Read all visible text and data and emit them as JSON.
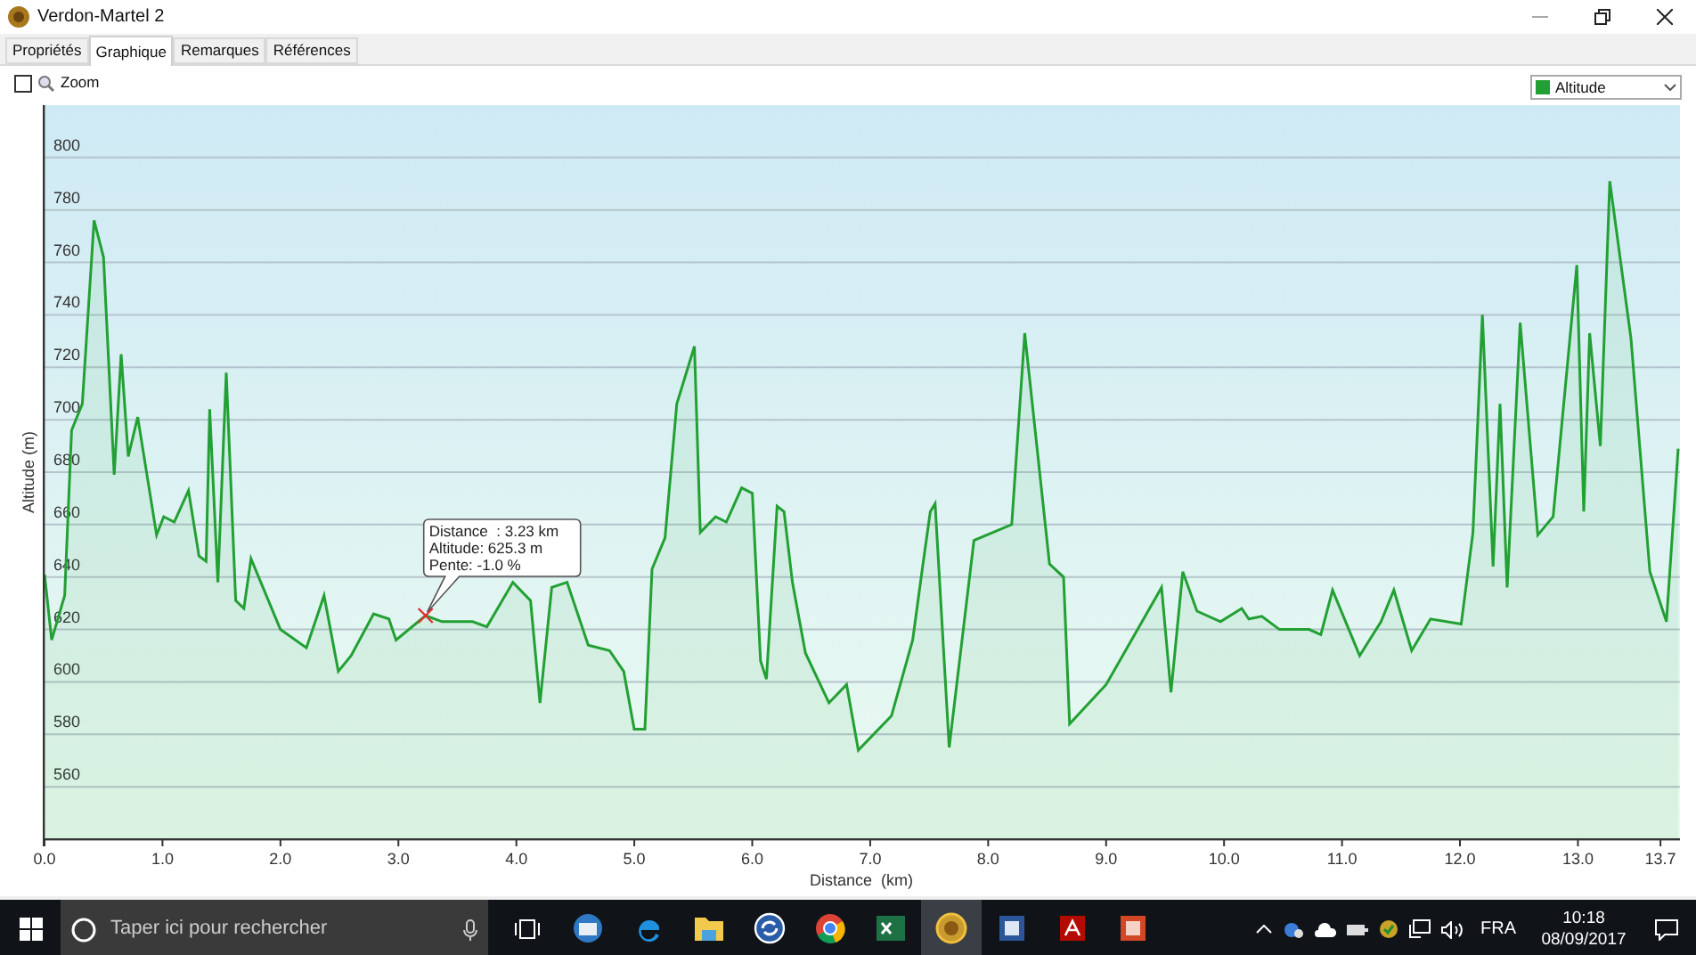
{
  "window": {
    "title": "Verdon-Martel 2"
  },
  "tabs": [
    {
      "label": "Propriétés",
      "selected": false
    },
    {
      "label": "Graphique",
      "selected": true
    },
    {
      "label": "Remarques",
      "selected": false
    },
    {
      "label": "Références",
      "selected": false
    }
  ],
  "toolbar": {
    "zoom": {
      "label": "Zoom",
      "checked": false
    }
  },
  "chart": {
    "chart_data": {
      "type": "area",
      "grid": true,
      "xlabel": "Distance  (km)",
      "ylabel": "Altitude (m)",
      "xlim": [
        0,
        13.85
      ],
      "ylim": [
        540,
        820
      ],
      "xticks": [
        {
          "value": 0,
          "label": "0.0"
        },
        {
          "value": 1,
          "label": "1.0"
        },
        {
          "value": 2,
          "label": "2.0"
        },
        {
          "value": 3,
          "label": "3.0"
        },
        {
          "value": 4,
          "label": "4.0"
        },
        {
          "value": 5,
          "label": "5.0"
        },
        {
          "value": 6,
          "label": "6.0"
        },
        {
          "value": 7,
          "label": "7.0"
        },
        {
          "value": 8,
          "label": "8.0"
        },
        {
          "value": 9,
          "label": "9.0"
        },
        {
          "value": 10,
          "label": "10.0"
        },
        {
          "value": 11,
          "label": "11.0"
        },
        {
          "value": 12,
          "label": "12.0"
        },
        {
          "value": 13,
          "label": "13.0"
        },
        {
          "value": 13.7,
          "label": "13.7"
        }
      ],
      "yticks": [
        560,
        580,
        600,
        620,
        640,
        660,
        680,
        700,
        720,
        740,
        760,
        780,
        800
      ],
      "x": [
        0,
        0.06,
        0.17,
        0.23,
        0.32,
        0.42,
        0.5,
        0.59,
        0.65,
        0.71,
        0.79,
        0.95,
        1.01,
        1.1,
        1.22,
        1.31,
        1.37,
        1.4,
        1.47,
        1.54,
        1.62,
        1.69,
        1.75,
        2.0,
        2.22,
        2.37,
        2.49,
        2.6,
        2.79,
        2.92,
        2.98,
        3.23,
        3.37,
        3.63,
        3.75,
        3.97,
        4.12,
        4.2,
        4.3,
        4.43,
        4.61,
        4.79,
        4.91,
        5.0,
        5.09,
        5.15,
        5.26,
        5.36,
        5.51,
        5.56,
        5.69,
        5.78,
        5.91,
        6.0,
        6.07,
        6.12,
        6.21,
        6.27,
        6.34,
        6.45,
        6.65,
        6.8,
        6.9,
        7.18,
        7.36,
        7.45,
        7.51,
        7.55,
        7.67,
        7.88,
        8.2,
        8.31,
        8.52,
        8.64,
        8.69,
        9.0,
        9.47,
        9.55,
        9.65,
        9.77,
        9.97,
        10.15,
        10.21,
        10.32,
        10.47,
        10.72,
        10.82,
        10.92,
        11.15,
        11.33,
        11.44,
        11.59,
        11.75,
        12.01,
        12.11,
        12.19,
        12.28,
        12.34,
        12.4,
        12.51,
        12.66,
        12.79,
        12.99,
        13.05,
        13.1,
        13.19,
        13.27,
        13.45,
        13.61,
        13.75,
        13.85
      ],
      "series": [
        {
          "name": "Altitude",
          "color": "#22a033",
          "values": [
            641,
            616,
            633,
            696,
            706,
            776,
            762,
            679,
            725,
            686,
            701,
            656,
            663,
            661,
            673,
            648,
            646,
            704,
            638,
            718,
            631,
            628,
            647,
            620,
            613,
            633,
            604,
            610,
            626,
            624,
            616,
            625.3,
            623,
            623,
            621,
            638,
            631,
            592,
            636,
            638,
            614,
            612,
            604,
            582,
            582,
            643,
            655,
            706,
            728,
            657,
            663,
            661,
            674,
            672,
            608,
            601,
            667,
            665,
            638,
            611,
            592,
            599,
            574,
            587,
            616,
            646,
            665,
            668,
            575,
            654,
            660,
            733,
            645,
            640,
            584,
            599,
            636,
            596,
            642,
            627,
            623,
            628,
            624,
            625,
            620,
            620,
            618,
            635,
            610,
            623,
            635,
            612,
            624,
            622,
            657,
            740,
            644,
            706,
            636,
            737,
            656,
            663,
            759,
            665,
            733,
            690,
            791,
            731,
            642,
            623,
            689
          ]
        }
      ],
      "annotations": [
        {
          "x": 3.23,
          "y": 625.3,
          "text": "Distance  : 3.23 km\nAltitude: 625.3 m\nPente: -1.0 %"
        }
      ]
    }
  },
  "taskbar": {
    "search": {
      "placeholder": "Taper ici pour rechercher"
    },
    "apps": [
      {
        "kind": "mail",
        "selected": false
      },
      {
        "kind": "edge",
        "selected": false
      },
      {
        "kind": "folder",
        "selected": false
      },
      {
        "kind": "sync",
        "selected": false
      },
      {
        "kind": "chrome",
        "selected": false
      },
      {
        "kind": "excel",
        "selected": false
      },
      {
        "kind": "app",
        "selected": true
      },
      {
        "kind": "word",
        "selected": false
      },
      {
        "kind": "pdf",
        "selected": false
      },
      {
        "kind": "slides",
        "selected": false
      }
    ],
    "language": "FRA",
    "time": "10:18",
    "date": "08/09/2017"
  }
}
